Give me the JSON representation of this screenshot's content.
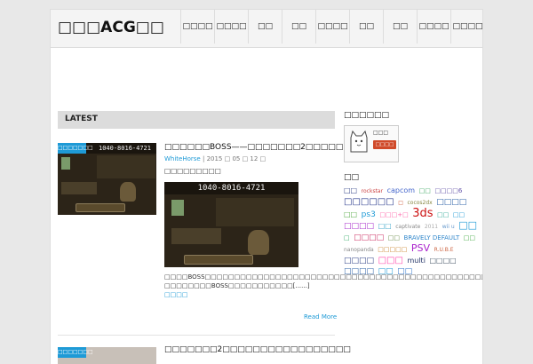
{
  "site": {
    "logo": "□□□ACG□□"
  },
  "nav": [
    "□□□□",
    "□□□□",
    "□□",
    "□□",
    "□□□□",
    "□□",
    "□□",
    "□□□□",
    "□□□□"
  ],
  "latest": {
    "label": "LATEST"
  },
  "posts": [
    {
      "title": "□□□□□□BOSS——□□□□□□□2□□□□□□□□□□□□",
      "author": "WhiteHorse",
      "date": "2015 □ 05 □ 12 □",
      "subtitle": "□□□□□□□□□",
      "thumb_text": "1040-8016-4721",
      "thumb_tag": "□□□□□□□",
      "excerpt": "□□□□BOSS□□□□□□□□□□□□□□□□□□□□□□□□□□□□□□□□□□□□□□□□□□□□□□□□□□□□□□□□□□□□□□□□□□□□□□□BOSS□□□□□□□□□□□□□□□□□□□□□□□□□□ □□□□□□□□BOSS□□□□□□□□□□□[......]",
      "more_link": "□□□□",
      "read_more": "Read More"
    },
    {
      "title": "□□□□□□□2□□□□□□□□□□□□□□□□□",
      "thumb_tag": "□□□□□□□"
    }
  ],
  "sidebar": {
    "login_title": "□□□□□□",
    "login_label": "□□□",
    "login_button": "□□□□",
    "tags_title": "□□",
    "tags": [
      {
        "t": "□□",
        "c": "#334488",
        "s": 8
      },
      {
        "t": "rockstar",
        "c": "#cc4444",
        "s": 6
      },
      {
        "t": "capcom",
        "c": "#4466cc",
        "s": 8
      },
      {
        "t": "□□",
        "c": "#44aa66",
        "s": 7
      },
      {
        "t": "□□□□6",
        "c": "#6655aa",
        "s": 7
      },
      {
        "t": "□□□□□□",
        "c": "#223388",
        "s": 10
      },
      {
        "t": "□",
        "c": "#cc5533",
        "s": 6
      },
      {
        "t": "cocos2dx",
        "c": "#888844",
        "s": 6
      },
      {
        "t": "□□□□",
        "c": "#3366aa",
        "s": 9
      },
      {
        "t": "□□",
        "c": "#55aa44",
        "s": 8
      },
      {
        "t": "ps3",
        "c": "#1e9ad6",
        "s": 9
      },
      {
        "t": "□□□+□",
        "c": "#ff66aa",
        "s": 7
      },
      {
        "t": "3ds",
        "c": "#cc1111",
        "s": 13
      },
      {
        "t": "□□",
        "c": "#33aa99",
        "s": 7
      },
      {
        "t": "□□",
        "c": "#1e9ad6",
        "s": 7
      },
      {
        "t": "□□□□",
        "c": "#aa33cc",
        "s": 9
      },
      {
        "t": "□□",
        "c": "#44aacc",
        "s": 8
      },
      {
        "t": "captivate",
        "c": "#888888",
        "s": 6
      },
      {
        "t": "2011",
        "c": "#aaaaaa",
        "s": 6
      },
      {
        "t": "wii u",
        "c": "#6699cc",
        "s": 6
      },
      {
        "t": "□□",
        "c": "#1e9ad6",
        "s": 11
      },
      {
        "t": "□",
        "c": "#33aa66",
        "s": 7
      },
      {
        "t": "□□□□",
        "c": "#cc3366",
        "s": 9
      },
      {
        "t": "□□",
        "c": "#668844",
        "s": 7
      },
      {
        "t": "BRAVELY DEFAULT",
        "c": "#3388cc",
        "s": 7
      },
      {
        "t": "□□",
        "c": "#44aa44",
        "s": 7
      },
      {
        "t": "nanopanda",
        "c": "#888888",
        "s": 6
      },
      {
        "t": "□□□□□",
        "c": "#cc8833",
        "s": 7
      },
      {
        "t": "PSV",
        "c": "#aa22cc",
        "s": 11
      },
      {
        "t": "R.U.B.E",
        "c": "#cc6644",
        "s": 6
      },
      {
        "t": "□□□□",
        "c": "#334488",
        "s": 9
      },
      {
        "t": "□□□",
        "c": "#ff44aa",
        "s": 10
      },
      {
        "t": "multi",
        "c": "#223366",
        "s": 8
      },
      {
        "t": "□□□□",
        "c": "#445566",
        "s": 8
      },
      {
        "t": "□□□□",
        "c": "#3366aa",
        "s": 9
      },
      {
        "t": "□□",
        "c": "#1e9ad6",
        "s": 9
      },
      {
        "t": "□□",
        "c": "#3377cc",
        "s": 9
      }
    ]
  }
}
